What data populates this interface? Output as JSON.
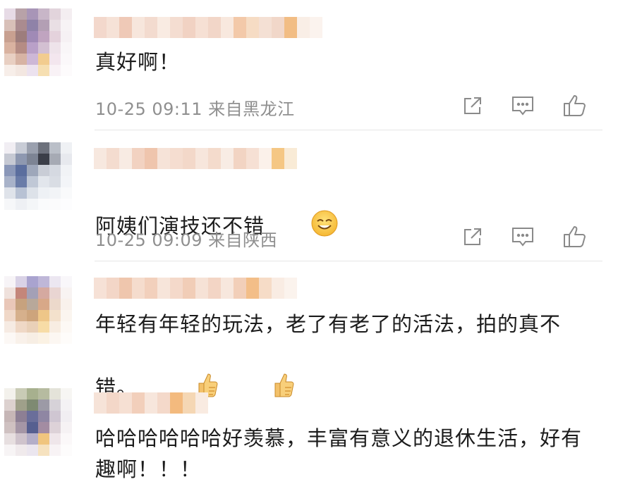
{
  "comments": [
    {
      "username": "",
      "text": "真好啊！",
      "time": "10-25 09:11",
      "location": "来自黑龙江",
      "emoji": [],
      "avatar_colors": [
        "#e7dbe6",
        "#b8a2a8",
        "#a895b7",
        "#c8b6c8",
        "#e2d4dc",
        "#f4eef1",
        "#d8c0b8",
        "#aa8b8f",
        "#8f82a8",
        "#b39fb4",
        "#e9dfe4",
        "#f7f3f5",
        "#c8a090",
        "#9d7d7c",
        "#a08ab6",
        "#c0a4c0",
        "#e4d2dc",
        "#f6f1f4",
        "#d9b2a0",
        "#b58c84",
        "#b9a0c8",
        "#d3c0d2",
        "#eee3ea",
        "#f9f6f8",
        "#e8cfc2",
        "#d7b3a4",
        "#cdb7d6",
        "#f2cc8f",
        "#f3e6ee",
        "#fbf8fa",
        "#f7eee9",
        "#f3e7e1",
        "#ece2ef",
        "#f6dfb2",
        "#f9f2f6",
        "#fdfbfc"
      ],
      "name_colors": [
        "#f3d8cc",
        "#f6e2d7",
        "#efc9b7",
        "#f7e6dc",
        "#f3dbcf",
        "#f9ebe2",
        "#f4ddd1",
        "#f1d2c3",
        "#f6e0d4",
        "#f2d6c8",
        "#f8e8de",
        "#f3c9a9",
        "#f6dcc4",
        "#f4e0d4",
        "#f1d7c9",
        "#f2bd84",
        "#f9eee6",
        "#fbf3ee"
      ]
    },
    {
      "username": "",
      "text": "阿姨们演技还不错",
      "time": "10-25 09:09",
      "location": "来自陕西",
      "emoji": [
        "smiling-face"
      ],
      "avatar_colors": [
        "#f1eef3",
        "#c8ccd6",
        "#9aa0ae",
        "#6d717c",
        "#babfc8",
        "#eff1f4",
        "#c6c9d3",
        "#8e98b0",
        "#7d8494",
        "#3b3e48",
        "#a6aab4",
        "#e7e9ee",
        "#8a97b8",
        "#5b6e9e",
        "#9ea7ba",
        "#c9cdd6",
        "#d5d9e1",
        "#f1f3f6",
        "#a8b2c9",
        "#6a7ca8",
        "#c0c8d6",
        "#e2e6ec",
        "#d9dde4",
        "#f3f5f8",
        "#dfe3ea",
        "#b8c2d4",
        "#dde2e9",
        "#eef1f5",
        "#f2f4f7",
        "#f9fafb",
        "#f6f7f9",
        "#eef0f4",
        "#f4f6f8",
        "#fafbfc",
        "#fbfbfc",
        "#fdfdfe"
      ],
      "name_colors": [
        "#f7e8df",
        "#f4dccf",
        "#f8ebe3",
        "#f2d2c1",
        "#efc5ad",
        "#f6e3d8",
        "#f5ddd0",
        "#f3d8c9",
        "#f7e6dc",
        "#f4dbcc",
        "#f8ece4",
        "#f2d4c3",
        "#f6e0d4",
        "#fbf1ea",
        "#f5c784",
        "#f9ebd6"
      ]
    },
    {
      "username": "",
      "text": "年轻有年轻的玩法，老了有老了的活法，拍的真不错。",
      "time": "",
      "location": "",
      "emoji": [
        "thumbs-up",
        "thumbs-up"
      ],
      "avatar_colors": [
        "#f7f4f7",
        "#d9d2e6",
        "#a9a3cf",
        "#bfb7d8",
        "#ece7f1",
        "#f9f7fa",
        "#efe1dc",
        "#c4867a",
        "#a4a0b6",
        "#d5a9a0",
        "#e9d5d2",
        "#f8f3f2",
        "#e9c7b8",
        "#c7a27e",
        "#b8a89a",
        "#d8a888",
        "#ecd9cb",
        "#f9f1ec",
        "#f0d8c8",
        "#d6b08c",
        "#cda47c",
        "#eec688",
        "#f3e1cc",
        "#fbf5ef",
        "#f6ebe3",
        "#efd8c6",
        "#e9d0b8",
        "#f7dca6",
        "#f8ede2",
        "#fdf9f5",
        "#fcf8f5",
        "#f9f1ea",
        "#f7eee4",
        "#fbf2e4",
        "#fcf7f2",
        "#fefcfa"
      ],
      "name_colors": [
        "#f6e1d6",
        "#f3d6c7",
        "#efc6ad",
        "#f5dccd",
        "#f2d0bc",
        "#f7e5da",
        "#f4d9ca",
        "#f1cdb7",
        "#f6e2d6",
        "#f3d5c5",
        "#f7e7dd",
        "#f2cfb9",
        "#f3be88",
        "#f6dcc7",
        "#f9ece3",
        "#fbf3ed"
      ]
    },
    {
      "username": "",
      "text": "哈哈哈哈哈哈好羡慕，丰富有意义的退休生活，好有趣啊！！！",
      "time": "",
      "location": "",
      "emoji": [],
      "avatar_colors": [
        "#f3f1ec",
        "#c9cbb5",
        "#a7b08e",
        "#b6bba0",
        "#e4e3d9",
        "#f7f6f3",
        "#dcd1cf",
        "#9fa08a",
        "#7e8a72",
        "#9c9aa6",
        "#d6d2d8",
        "#f4f2f4",
        "#c6b6b6",
        "#8d7f94",
        "#6a6e9a",
        "#8f86a3",
        "#cfc6d2",
        "#f1eef2",
        "#cfc1c1",
        "#a596a6",
        "#565f90",
        "#a38ca2",
        "#ddd2d8",
        "#f6f2f4",
        "#e7dfe0",
        "#cfc3cc",
        "#b4aec8",
        "#f0c57e",
        "#efe6ea",
        "#fbf8f9",
        "#f7f4f5",
        "#f0eaec",
        "#ebe6ef",
        "#f6e2bf",
        "#f8f3f5",
        "#fdfcfc"
      ],
      "name_colors": [
        "#f6e3d8",
        "#f3d7c8",
        "#f6e0d3",
        "#f2cfbb",
        "#f7e6dc",
        "#f4d9ca",
        "#f3ba7e",
        "#f5d7b4",
        "#f9ebe1"
      ]
    }
  ],
  "icons": {
    "share": "share-icon",
    "reply": "comment-icon",
    "like": "thumbs-up-icon"
  }
}
